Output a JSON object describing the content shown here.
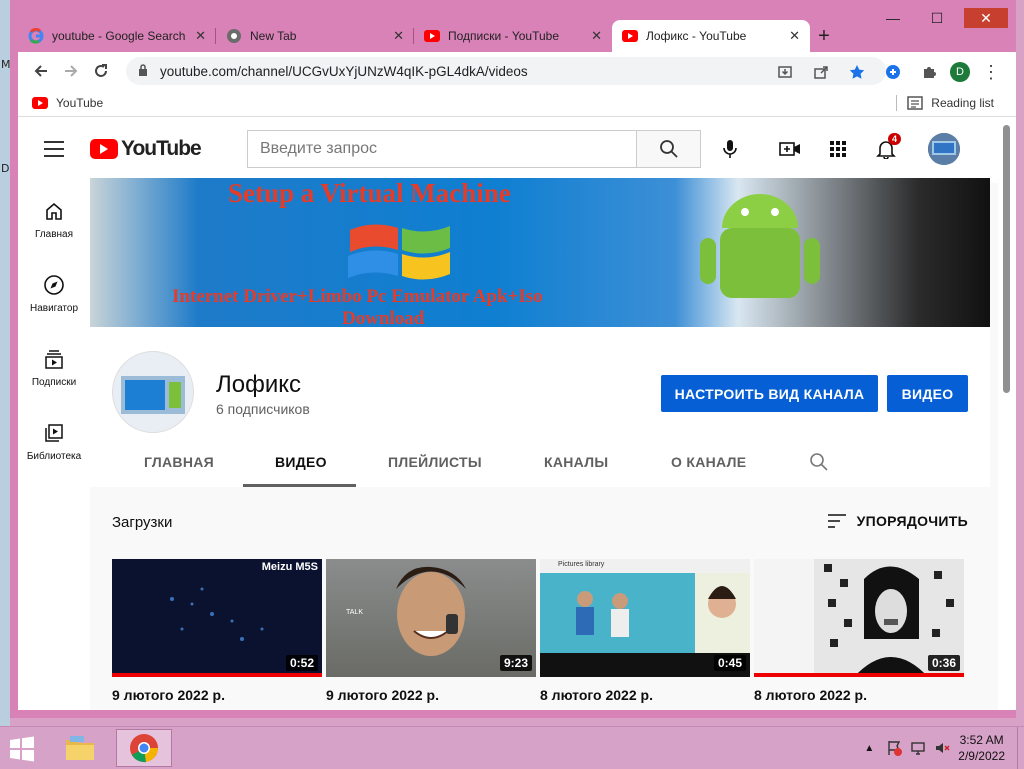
{
  "desktop": {
    "edge_letters": [
      "M",
      "D"
    ]
  },
  "window": {
    "minimize": "—",
    "maximize": "☐",
    "close": "✕"
  },
  "tabs": [
    {
      "title": "youtube - Google Search",
      "icon": "google-icon"
    },
    {
      "title": "New Tab",
      "icon": "chrome-icon"
    },
    {
      "title": "Подписки - YouTube",
      "icon": "youtube-icon"
    },
    {
      "title": "Лофикс - YouTube",
      "icon": "youtube-icon",
      "active": true
    }
  ],
  "toolbar": {
    "url": "youtube.com/channel/UCGvUxYjUNzW4qIK-pGL4dkA/videos",
    "profile_initial": "D"
  },
  "bookmarks": {
    "items": [
      "YouTube"
    ],
    "reading_list": "Reading list"
  },
  "youtube": {
    "logo": "YouTube",
    "search_placeholder": "Введите запрос",
    "notifications_count": "4",
    "guide": [
      {
        "label": "Главная",
        "icon": "home-icon"
      },
      {
        "label": "Навигатор",
        "icon": "compass-icon"
      },
      {
        "label": "Подписки",
        "icon": "subscriptions-icon"
      },
      {
        "label": "Библиотека",
        "icon": "library-icon"
      }
    ],
    "banner": {
      "title": "Setup a Virtual Machine",
      "subtitle": "Internet Driver+Limbo Pc Emulator Apk+Iso",
      "subtitle2": "Download"
    },
    "channel": {
      "name": "Лофикс",
      "subscribers": "6 подписчиков",
      "customize_button": "НАСТРОИТЬ ВИД КАНАЛА",
      "video_button": "ВИДЕО"
    },
    "channel_tabs": [
      "ГЛАВНАЯ",
      "ВИДЕО",
      "ПЛЕЙЛИСТЫ",
      "КАНАЛЫ",
      "О КАНАЛЕ"
    ],
    "active_tab": "ВИДЕО",
    "section_title": "Загрузки",
    "sort_label": "УПОРЯДОЧИТЬ",
    "videos": [
      {
        "duration": "0:52",
        "date": "9 лютого 2022 р.",
        "thumb_text": "Meizu M5S"
      },
      {
        "duration": "9:23",
        "date": "9 лютого 2022 р.",
        "thumb_text": "TALK"
      },
      {
        "duration": "0:45",
        "date": "8 лютого 2022 р.",
        "thumb_text": "Pictures library"
      },
      {
        "duration": "0:36",
        "date": "8 лютого 2022 р.",
        "thumb_text": ""
      }
    ]
  },
  "taskbar": {
    "time": "3:52 AM",
    "date": "2/9/2022"
  }
}
